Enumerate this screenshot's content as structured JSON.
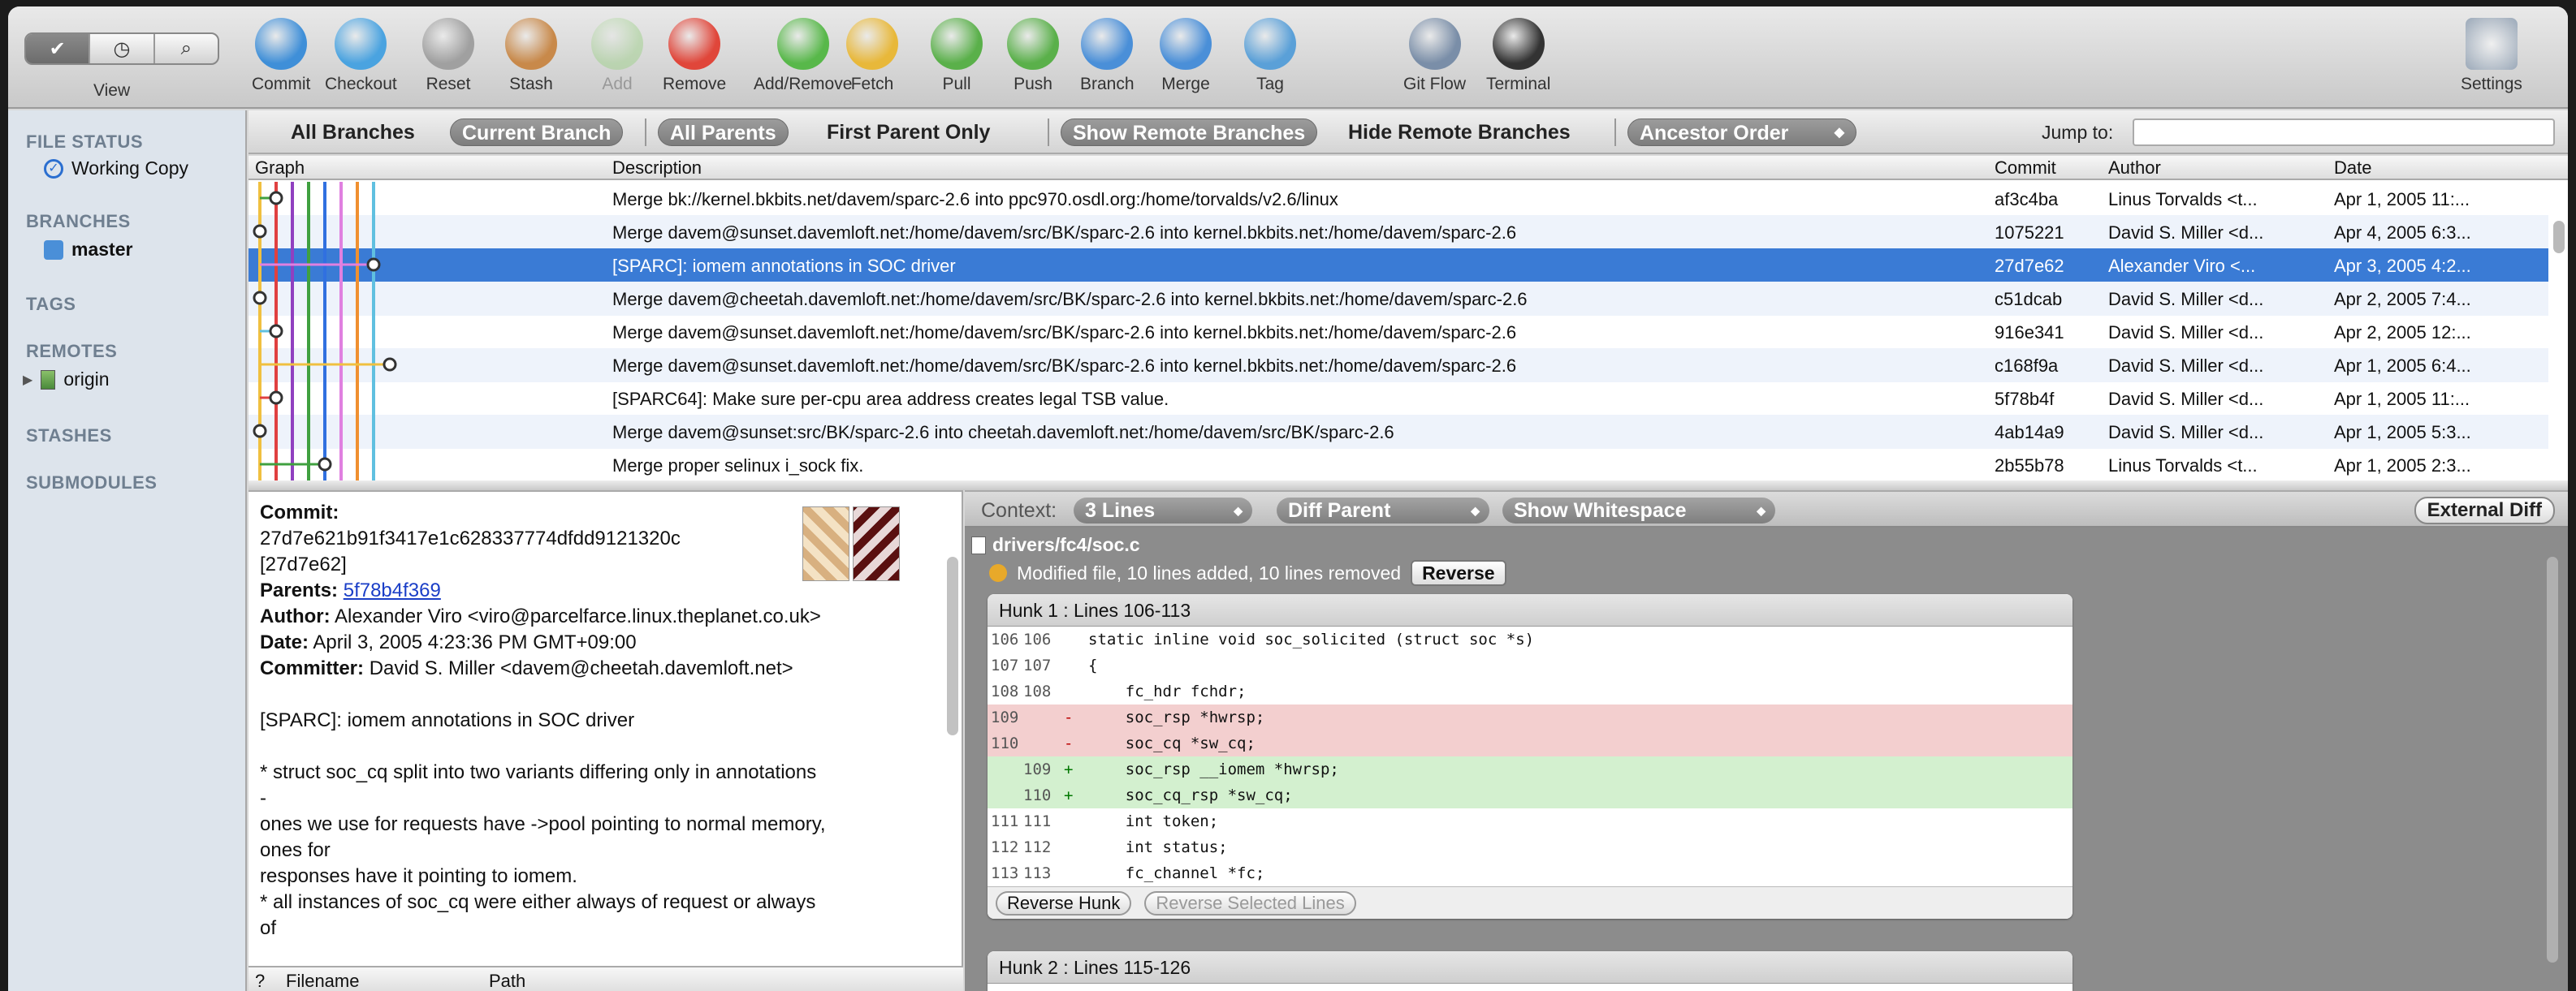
{
  "toolbar": {
    "view_label": "View",
    "view_segments": [
      "✔",
      "◷",
      "⌕"
    ],
    "buttons": [
      {
        "label": "Commit",
        "icon": "commit-icon",
        "color": "#3f8fd8"
      },
      {
        "label": "Checkout",
        "icon": "checkout-icon",
        "color": "#4aa3e0"
      },
      {
        "label": "Reset",
        "icon": "trash-icon",
        "color": "#a0a0a0"
      },
      {
        "label": "Stash",
        "icon": "stash-box-icon",
        "color": "#c8894a"
      },
      {
        "label": "Add",
        "icon": "add-icon",
        "color": "#9ed08a",
        "disabled": true
      },
      {
        "label": "Remove",
        "icon": "remove-icon",
        "color": "#e0463a"
      },
      {
        "label": "Add/Remove",
        "icon": "add-remove-icon",
        "color": "#58b84a"
      },
      {
        "label": "Fetch",
        "icon": "fetch-arrow-icon",
        "color": "#e8b83a"
      },
      {
        "label": "Pull",
        "icon": "pull-arrow-icon",
        "color": "#5ab04a"
      },
      {
        "label": "Push",
        "icon": "push-arrow-icon",
        "color": "#5ab04a"
      },
      {
        "label": "Branch",
        "icon": "branch-icon",
        "color": "#4a8fd8"
      },
      {
        "label": "Merge",
        "icon": "merge-icon",
        "color": "#4a8fd8"
      },
      {
        "label": "Tag",
        "icon": "tag-icon",
        "color": "#5aa0d8"
      },
      {
        "label": "Git Flow",
        "icon": "git-flow-icon",
        "color": "#7a8ea8"
      },
      {
        "label": "Terminal",
        "icon": "terminal-icon",
        "color": "#333333"
      }
    ],
    "settings_label": "Settings"
  },
  "sidebar": {
    "file_status": "FILE STATUS",
    "working_copy": "Working Copy",
    "branches": "BRANCHES",
    "master": "master",
    "tags": "TAGS",
    "remotes": "REMOTES",
    "origin": "origin",
    "stashes": "STASHES",
    "submodules": "SUBMODULES"
  },
  "filterbar": {
    "all_branches": "All Branches",
    "current_branch": "Current Branch",
    "all_parents": "All Parents",
    "first_parent_only": "First Parent Only",
    "show_remote": "Show Remote Branches",
    "hide_remote": "Hide Remote Branches",
    "ancestor_order": "Ancestor Order",
    "jump_to": "Jump to:"
  },
  "history": {
    "columns": {
      "graph": "Graph",
      "description": "Description",
      "commit": "Commit",
      "author": "Author",
      "date": "Date"
    },
    "rows": [
      {
        "desc": "Merge bk://kernel.bkbits.net/davem/sparc-2.6 into ppc970.osdl.org:/home/torvalds/v2.6/linux",
        "commit": "af3c4ba",
        "author": "Linus Torvalds <t...",
        "date": "Apr 1, 2005 11:..."
      },
      {
        "desc": "Merge davem@sunset.davemloft.net:/home/davem/src/BK/sparc-2.6 into kernel.bkbits.net:/home/davem/sparc-2.6",
        "commit": "1075221",
        "author": "David S. Miller <d...",
        "date": "Apr 4, 2005 6:3..."
      },
      {
        "desc": "[SPARC]: iomem annotations in SOC driver",
        "commit": "27d7e62",
        "author": "Alexander Viro <...",
        "date": "Apr 3, 2005 4:2..."
      },
      {
        "desc": "Merge davem@cheetah.davemloft.net:/home/davem/src/BK/sparc-2.6 into kernel.bkbits.net:/home/davem/sparc-2.6",
        "commit": "c51dcab",
        "author": "David S. Miller <d...",
        "date": "Apr 2, 2005 7:4..."
      },
      {
        "desc": "Merge davem@sunset.davemloft.net:/home/davem/src/BK/sparc-2.6 into kernel.bkbits.net:/home/davem/sparc-2.6",
        "commit": "916e341",
        "author": "David S. Miller <d...",
        "date": "Apr 2, 2005 12:..."
      },
      {
        "desc": "Merge davem@sunset.davemloft.net:/home/davem/src/BK/sparc-2.6 into kernel.bkbits.net:/home/davem/sparc-2.6",
        "commit": "c168f9a",
        "author": "David S. Miller <d...",
        "date": "Apr 1, 2005 6:4..."
      },
      {
        "desc": "[SPARC64]: Make sure per-cpu area address creates legal TSB value.",
        "commit": "5f78b4f",
        "author": "David S. Miller <d...",
        "date": "Apr 1, 2005 11:..."
      },
      {
        "desc": "Merge davem@sunset:src/BK/sparc-2.6 into cheetah.davemloft.net:/home/davem/src/BK/sparc-2.6",
        "commit": "4ab14a9",
        "author": "David S. Miller <d...",
        "date": "Apr 1, 2005 5:3..."
      },
      {
        "desc": "Merge proper selinux i_sock fix.",
        "commit": "2b55b78",
        "author": "Linus Torvalds <t...",
        "date": "Apr 1, 2005 2:3..."
      }
    ],
    "graph_colors": [
      "#f0c040",
      "#e04040",
      "#9040c0",
      "#40a040",
      "#3070e0",
      "#e080e0",
      "#f09030",
      "#60c0e0"
    ]
  },
  "details": {
    "commit_label": "Commit:",
    "commit_hash": "27d7e621b91f3417e1c628337774dfdd9121320c",
    "short_hash": "[27d7e62]",
    "parents_label": "Parents:",
    "parents_value": "5f78b4f369",
    "author_label": "Author:",
    "author_value": "Alexander Viro <viro@parcelfarce.linux.theplanet.co.uk>",
    "date_label": "Date:",
    "date_value": "April 3, 2005 4:23:36 PM GMT+09:00",
    "committer_label": "Committer:",
    "committer_value": "David S. Miller <davem@cheetah.davemloft.net>",
    "message_title": "[SPARC]: iomem annotations in SOC driver",
    "message_lines": [
      "* struct soc_cq split into two variants differing only in annotations",
      "-",
      "ones we use for requests have ->pool pointing to normal memory,",
      "ones for",
      "responses have it pointing to iomem.",
      "* all instances of soc_cq were either always of request or always",
      "of"
    ],
    "file_columns": {
      "status": "?",
      "filename": "Filename",
      "path": "Path"
    }
  },
  "diff": {
    "context_label": "Context:",
    "context_value": "3 Lines",
    "diff_parent": "Diff Parent",
    "show_whitespace": "Show Whitespace",
    "external_diff": "External Diff",
    "file_path": "drivers/fc4/soc.c",
    "file_info": "Modified file, 10 lines added, 10 lines removed",
    "reverse": "Reverse",
    "hunk1_title": "Hunk 1 : Lines 106-113",
    "hunk1_lines": [
      {
        "o": "106",
        "n": "106",
        "m": "",
        "t": "normal",
        "c": "static inline void soc_solicited (struct soc *s)"
      },
      {
        "o": "107",
        "n": "107",
        "m": "",
        "t": "normal",
        "c": "{"
      },
      {
        "o": "108",
        "n": "108",
        "m": "",
        "t": "normal",
        "c": "    fc_hdr fchdr;"
      },
      {
        "o": "109",
        "n": "",
        "m": "-",
        "t": "rm",
        "c": "    soc_rsp *hwrsp;"
      },
      {
        "o": "110",
        "n": "",
        "m": "-",
        "t": "rm",
        "c": "    soc_cq *sw_cq;"
      },
      {
        "o": "",
        "n": "109",
        "m": "+",
        "t": "ad",
        "c": "    soc_rsp __iomem *hwrsp;"
      },
      {
        "o": "",
        "n": "110",
        "m": "+",
        "t": "ad",
        "c": "    soc_cq_rsp *sw_cq;"
      },
      {
        "o": "111",
        "n": "111",
        "m": "",
        "t": "normal",
        "c": "    int token;"
      },
      {
        "o": "112",
        "n": "112",
        "m": "",
        "t": "normal",
        "c": "    int status;"
      },
      {
        "o": "113",
        "n": "113",
        "m": "",
        "t": "normal",
        "c": "    fc_channel *fc;"
      }
    ],
    "reverse_hunk": "Reverse Hunk",
    "reverse_selected": "Reverse Selected Lines",
    "hunk2_title": "Hunk 2 : Lines 115-126"
  }
}
